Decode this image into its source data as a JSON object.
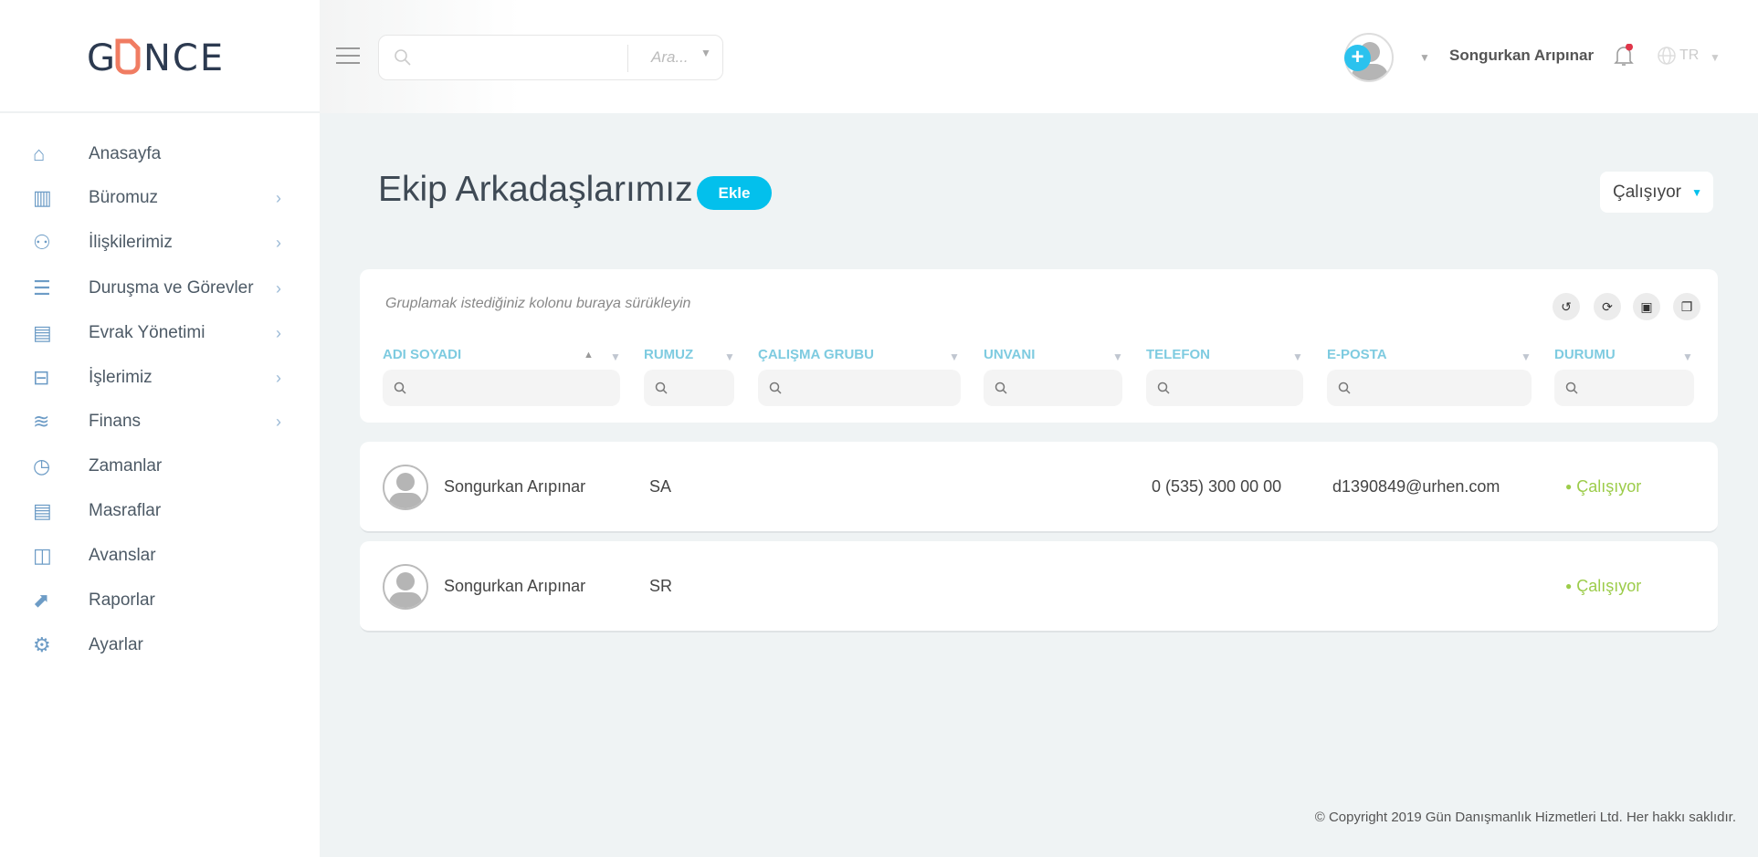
{
  "logo": "GÜNCE",
  "sidebar": {
    "items": [
      {
        "label": "Anasayfa",
        "icon": "home-icon",
        "has_children": false
      },
      {
        "label": "Büromuz",
        "icon": "building-icon",
        "has_children": true
      },
      {
        "label": "İlişkilerimiz",
        "icon": "users-icon",
        "has_children": true
      },
      {
        "label": "Duruşma ve Görevler",
        "icon": "clipboard-icon",
        "has_children": true
      },
      {
        "label": "Evrak Yönetimi",
        "icon": "document-icon",
        "has_children": true
      },
      {
        "label": "İşlerimiz",
        "icon": "briefcase-icon",
        "has_children": true
      },
      {
        "label": "Finans",
        "icon": "money-icon",
        "has_children": true
      },
      {
        "label": "Zamanlar",
        "icon": "clock-icon",
        "has_children": false
      },
      {
        "label": "Masraflar",
        "icon": "receipt-icon",
        "has_children": false
      },
      {
        "label": "Avanslar",
        "icon": "wallet-icon",
        "has_children": false
      },
      {
        "label": "Raporlar",
        "icon": "chart-icon",
        "has_children": false
      },
      {
        "label": "Ayarlar",
        "icon": "gear-icon",
        "has_children": false
      }
    ]
  },
  "header": {
    "search_placeholder": "",
    "search_scope": "Ara...",
    "user_name": "Songurkan Arıpınar",
    "language": "TR"
  },
  "page": {
    "title": "Ekip Arkadaşlarımız",
    "add_label": "Ekle",
    "status_filter": "Çalışıyor"
  },
  "grid": {
    "group_hint": "Gruplamak istediğiniz kolonu buraya sürükleyin",
    "columns": [
      "ADI SOYADI",
      "RUMUZ",
      "ÇALIŞMA GRUBU",
      "UNVANI",
      "TELEFON",
      "E-POSTA",
      "DURUMU"
    ],
    "rows": [
      {
        "name": "Songurkan Arıpınar",
        "alias": "SA",
        "group": "",
        "title": "",
        "phone": "0 (535) 300 00 00",
        "email": "d1390849@urhen.com",
        "status": "Çalışıyor"
      },
      {
        "name": "Songurkan Arıpınar",
        "alias": "SR",
        "group": "",
        "title": "",
        "phone": "",
        "email": "",
        "status": "Çalışıyor"
      }
    ]
  },
  "footer": "© Copyright 2019 Gün Danışmanlık Hizmetleri Ltd. Her hakkı saklıdır.",
  "colors": {
    "accent": "#03c0ec",
    "status_active": "#9ccc4a",
    "logo_dark": "#2c3a50",
    "logo_orange": "#f07c62"
  }
}
